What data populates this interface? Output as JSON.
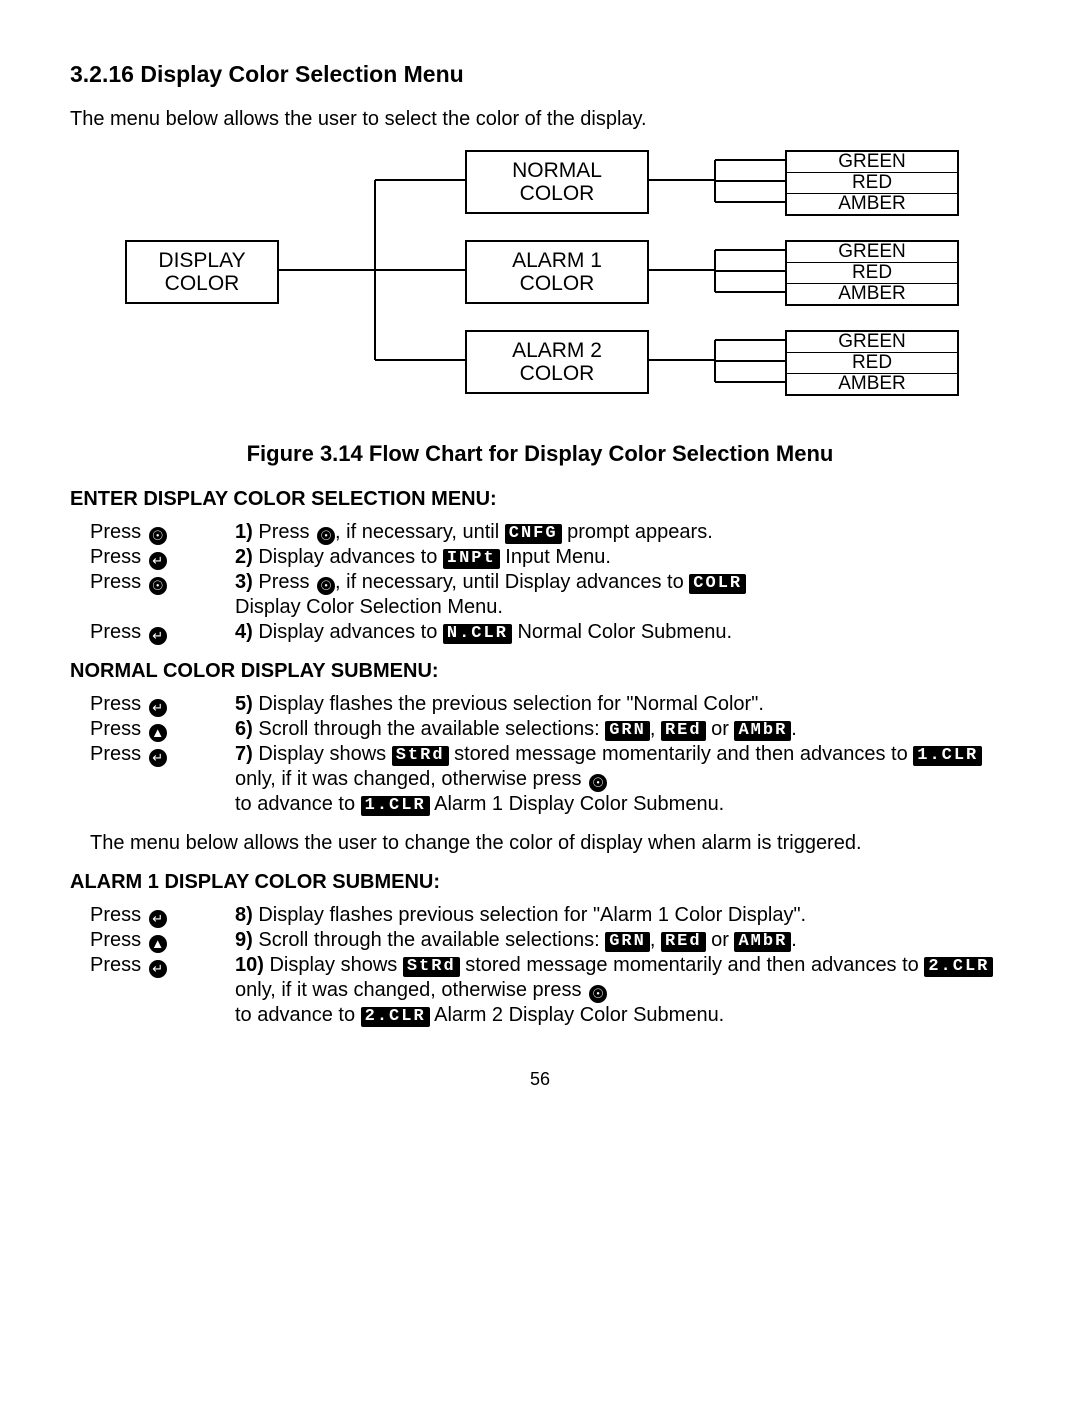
{
  "section": {
    "number": "3.2.16",
    "title": "Display Color Selection Menu"
  },
  "intro": "The menu below allows the user to select the color of the display.",
  "diagram": {
    "root": {
      "line1": "DISPLAY",
      "line2": "COLOR"
    },
    "branches": [
      {
        "line1": "NORMAL",
        "line2": "COLOR"
      },
      {
        "line1": "ALARM 1",
        "line2": "COLOR"
      },
      {
        "line1": "ALARM 2",
        "line2": "COLOR"
      }
    ],
    "leaves": [
      "GREEN",
      "RED",
      "AMBER"
    ]
  },
  "figure_caption": "Figure 3.14 Flow Chart for Display Color Selection Menu",
  "sub1": {
    "heading": "ENTER DISPLAY COLOR SELECTION MENU:",
    "steps": [
      {
        "press": "Press",
        "icon": "menu",
        "num": "1)",
        "pre": " Press ",
        "mid_icon": "menu",
        "post1": ", if necessary, until ",
        "seg": "CNFG",
        "post2": " prompt appears."
      },
      {
        "press": "Press",
        "icon": "enter",
        "num": "2)",
        "pre": " Display advances to ",
        "seg": "INPt",
        "post2": " Input Menu."
      },
      {
        "press": "Press",
        "icon": "menu",
        "num": "3)",
        "pre": " Press ",
        "mid_icon": "menu",
        "post1": ", if necessary, until Display advances to ",
        "seg": "COLR",
        "cont": "Display Color Selection Menu."
      },
      {
        "press": "Press",
        "icon": "enter",
        "num": "4)",
        "pre": " Display advances to ",
        "seg": "N.CLR",
        "post2": " Normal Color Submenu."
      }
    ]
  },
  "sub2": {
    "heading": "NORMAL COLOR DISPLAY SUBMENU:",
    "steps": [
      {
        "press": "Press",
        "icon": "enter",
        "num": "5)",
        "text": " Display flashes the previous selection for \"Normal Color\"."
      },
      {
        "press": "Press",
        "icon": "up",
        "num": "6)",
        "pre": " Scroll through the available selections: ",
        "seg1": "GRN",
        "mid": ", ",
        "seg2": "REd",
        "mid2": " or ",
        "seg3": "AMbR",
        "post": "."
      },
      {
        "press": "Press",
        "icon": "enter",
        "num": "7)",
        "pre": " Display shows ",
        "seg": "StRd",
        "post1": " stored message momentarily and then advances to ",
        "seg2": "1.CLR",
        "post2": " only, if it was changed, otherwise press ",
        "post_icon": "menu",
        "cont": "to advance to ",
        "seg3": "1.CLR",
        "post3": " Alarm 1 Display Color Submenu."
      }
    ]
  },
  "note": "The menu below allows the user to change the color of display when alarm is triggered.",
  "sub3": {
    "heading": "ALARM 1 DISPLAY COLOR SUBMENU:",
    "steps": [
      {
        "press": "Press",
        "icon": "enter",
        "num": "8)",
        "text": " Display flashes previous selection for \"Alarm 1 Color Display\"."
      },
      {
        "press": "Press",
        "icon": "up",
        "num": "9)",
        "pre": " Scroll through the available selections: ",
        "seg1": "GRN",
        "mid": ", ",
        "seg2": "REd",
        "mid2": " or ",
        "seg3": "AMbR",
        "post": "."
      },
      {
        "press": "Press",
        "icon": "enter",
        "num": "10)",
        "pre": " Display shows ",
        "seg": "StRd",
        "post1": " stored message momentarily and then advances to ",
        "seg2": "2.CLR",
        "post2": " only, if it was changed, otherwise press ",
        "post_icon": "menu",
        "cont": "to advance to ",
        "seg3": "2.CLR",
        "post3": " Alarm 2 Display Color Submenu."
      }
    ]
  },
  "page_number": "56",
  "icons": {
    "menu": "☉",
    "enter": "↵",
    "up": "▲"
  }
}
